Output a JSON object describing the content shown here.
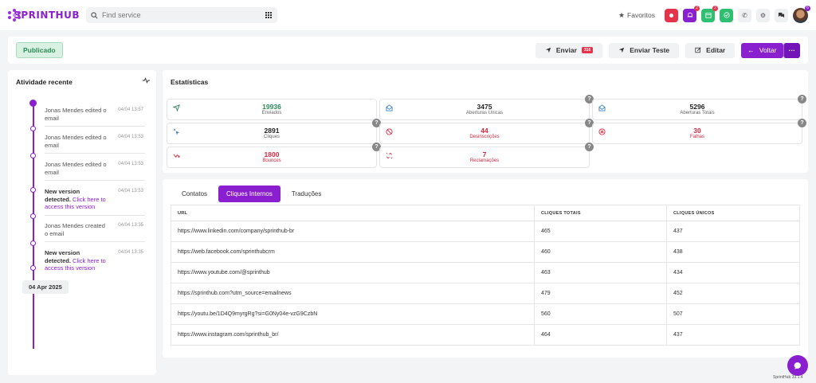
{
  "header": {
    "brand": "SPRINTHUB",
    "search_placeholder": "Find service",
    "favorites_label": "Favoritos",
    "bell_badge": "2",
    "calendar_badge": "2",
    "avatar_badge": "6"
  },
  "toolbar": {
    "status": "Publicado",
    "send_label": "Enviar",
    "send_count": "316",
    "test_label": "Enviar Teste",
    "edit_label": "Editar",
    "back_label": "Voltar",
    "more_label": "···"
  },
  "activity": {
    "title": "Atividade recente",
    "items": [
      {
        "text": "Jonas Mendes edited o email",
        "time": "04/04 13:57"
      },
      {
        "text": "Jonas Mendes edited o email",
        "time": "04/04 13:53"
      },
      {
        "text": "Jonas Mendes edited o email",
        "time": "04/04 13:53"
      },
      {
        "bold": "New version detected.",
        "link": "Click here to access this version",
        "time": "04/04 13:53"
      },
      {
        "text": "Jonas Mendes created o email",
        "time": "04/04 13:35"
      },
      {
        "bold": "New version detected.",
        "link": "Click here to access this version",
        "time": "04/04 13:35"
      }
    ],
    "date": "04 Apr 2025"
  },
  "stats": {
    "title": "Estatísticas",
    "cards": [
      {
        "value": "19936",
        "label": "Enviados",
        "color": "#2b8a57"
      },
      {
        "value": "3475",
        "label": "Aberturas Únicas",
        "color": "#222222"
      },
      {
        "value": "5296",
        "label": "Aberturas Totais",
        "color": "#222222"
      },
      {
        "value": "2891",
        "label": "Cliques",
        "color": "#222222"
      },
      {
        "value": "44",
        "label": "Desinscrições",
        "color": "#d4283e"
      },
      {
        "value": "30",
        "label": "Falhas",
        "color": "#d4283e"
      },
      {
        "value": "1800",
        "label": "Bounces",
        "color": "#d4283e"
      },
      {
        "value": "7",
        "label": "Reclamações",
        "color": "#d4283e"
      }
    ]
  },
  "links": {
    "tabs": [
      "Contatos",
      "Cliques Internos",
      "Traduções"
    ],
    "columns": [
      "URL",
      "CLIQUES TOTAIS",
      "CLIQUES ÚNICOS"
    ],
    "rows": [
      [
        "https://www.linkedin.com/company/sprinthub-br",
        "465",
        "437"
      ],
      [
        "https://web.facebook.com/sprinthubcrm",
        "460",
        "438"
      ],
      [
        "https://www.youtube.com/@sprinthub",
        "463",
        "434"
      ],
      [
        "https://sprinthub.com?utm_source=emailnews",
        "479",
        "452"
      ],
      [
        "https://youtu.be/1D4Q9myrgRg?si=G0Ny04e-vzG9CzbN",
        "560",
        "507"
      ],
      [
        "https://www.instagram.com/sprinthub_br/",
        "464",
        "437"
      ]
    ]
  },
  "footer": {
    "version": "SprintHub 33.1.4"
  },
  "colors": {
    "accent": "#8a1fd0",
    "danger": "#d4283e",
    "success": "#2b8a57"
  }
}
